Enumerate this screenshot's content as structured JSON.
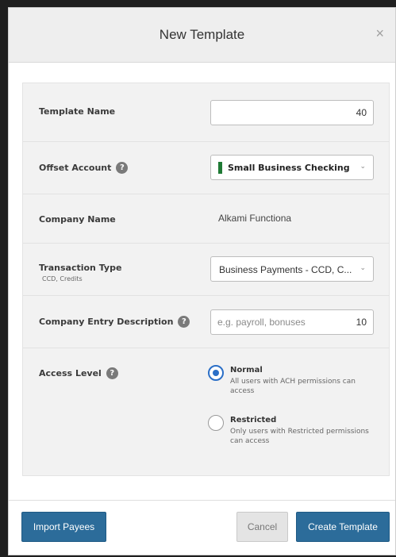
{
  "dialog": {
    "title": "New Template",
    "close_glyph": "×"
  },
  "form": {
    "template_name": {
      "label": "Template Name",
      "value": "",
      "counter": "40"
    },
    "offset_account": {
      "label": "Offset Account",
      "help_glyph": "?",
      "selected": "Small Business Checking",
      "account_color": "#1f7a35",
      "chevron_glyph": "⌄"
    },
    "company_name": {
      "label": "Company Name",
      "value": "Alkami Functiona"
    },
    "transaction_type": {
      "label": "Transaction Type",
      "sublabel": "CCD, Credits",
      "selected": "Business Payments - CCD, C...",
      "chevron_glyph": "⌄"
    },
    "company_entry_description": {
      "label": "Company Entry Description",
      "help_glyph": "?",
      "placeholder": "e.g. payroll, bonuses",
      "counter": "10"
    },
    "access_level": {
      "label": "Access Level",
      "help_glyph": "?",
      "options": [
        {
          "title": "Normal",
          "description": "All users with ACH permissions can access",
          "selected": true
        },
        {
          "title": "Restricted",
          "description": "Only users with Restricted permissions can access",
          "selected": false
        }
      ]
    }
  },
  "footer": {
    "import_payees_label": "Import Payees",
    "cancel_label": "Cancel",
    "create_template_label": "Create Template"
  },
  "colors": {
    "primary_button": "#2c6c9a",
    "radio_selected": "#2b6fc7",
    "header_bg": "#eeeeee",
    "panel_bg": "#f2f2f2"
  }
}
